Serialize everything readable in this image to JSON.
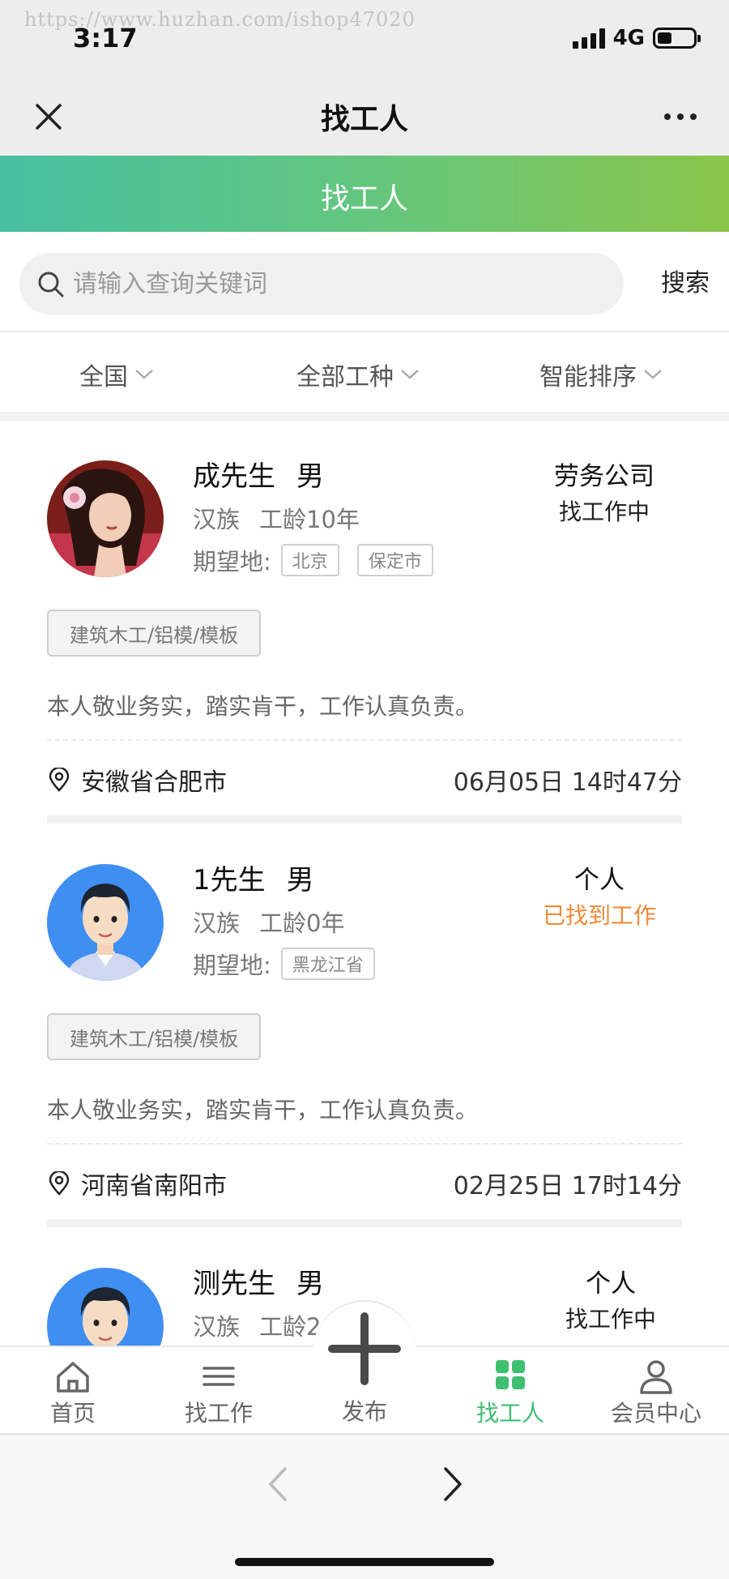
{
  "watermark": "https://www.huzhan.com/ishop47020",
  "status_bar": {
    "time": "3:17",
    "network": "4G",
    "battery_level": 0.4
  },
  "nav": {
    "title": "找工人",
    "close_icon": "close-icon",
    "more_icon": "more-dots-icon"
  },
  "banner": {
    "title": "找工人",
    "gradient": [
      "#47c0a1",
      "#8ac64a"
    ]
  },
  "search": {
    "placeholder": "请输入查询关键词",
    "value": "",
    "button_label": "搜索"
  },
  "filters": [
    {
      "label": "全国"
    },
    {
      "label": "全部工种"
    },
    {
      "label": "智能排序"
    }
  ],
  "workers": [
    {
      "name": "成先生",
      "gender": "男",
      "ethnicity": "汉族",
      "experience": "工龄10年",
      "expect_label": "期望地:",
      "places": [
        "北京",
        "保定市"
      ],
      "org_type": "劳务公司",
      "status": "找工作中",
      "status_found": false,
      "skill": "建筑木工/铝模/模板",
      "description": "本人敬业务实，踏实肯干，工作认真负责。",
      "location": "安徽省合肥市",
      "date": "06月05日 14时47分",
      "avatar": "costume-woman-avatar"
    },
    {
      "name": "1先生",
      "gender": "男",
      "ethnicity": "汉族",
      "experience": "工龄0年",
      "expect_label": "期望地:",
      "places": [
        "黑龙江省"
      ],
      "org_type": "个人",
      "status": "已找到工作",
      "status_found": true,
      "skill": "建筑木工/铝模/模板",
      "description": "本人敬业务实，踏实肯干，工作认真负责。",
      "location": "河南省南阳市",
      "date": "02月25日 17时14分",
      "avatar": "cartoon-man-avatar"
    },
    {
      "name": "测先生",
      "gender": "男",
      "ethnicity": "汉族",
      "experience": "工龄2",
      "org_type": "个人",
      "status": "找工作中",
      "status_found": false,
      "avatar": "cartoon-man-avatar"
    }
  ],
  "tabbar": [
    {
      "label": "首页",
      "icon": "home-icon"
    },
    {
      "label": "找工作",
      "icon": "list-icon"
    },
    {
      "label": "发布",
      "icon": "plus-icon"
    },
    {
      "label": "找工人",
      "icon": "grid-icon",
      "active": true
    },
    {
      "label": "会员中心",
      "icon": "person-icon"
    }
  ],
  "colors": {
    "accent": "#3fbf70",
    "found_status": "#f08a3a"
  }
}
